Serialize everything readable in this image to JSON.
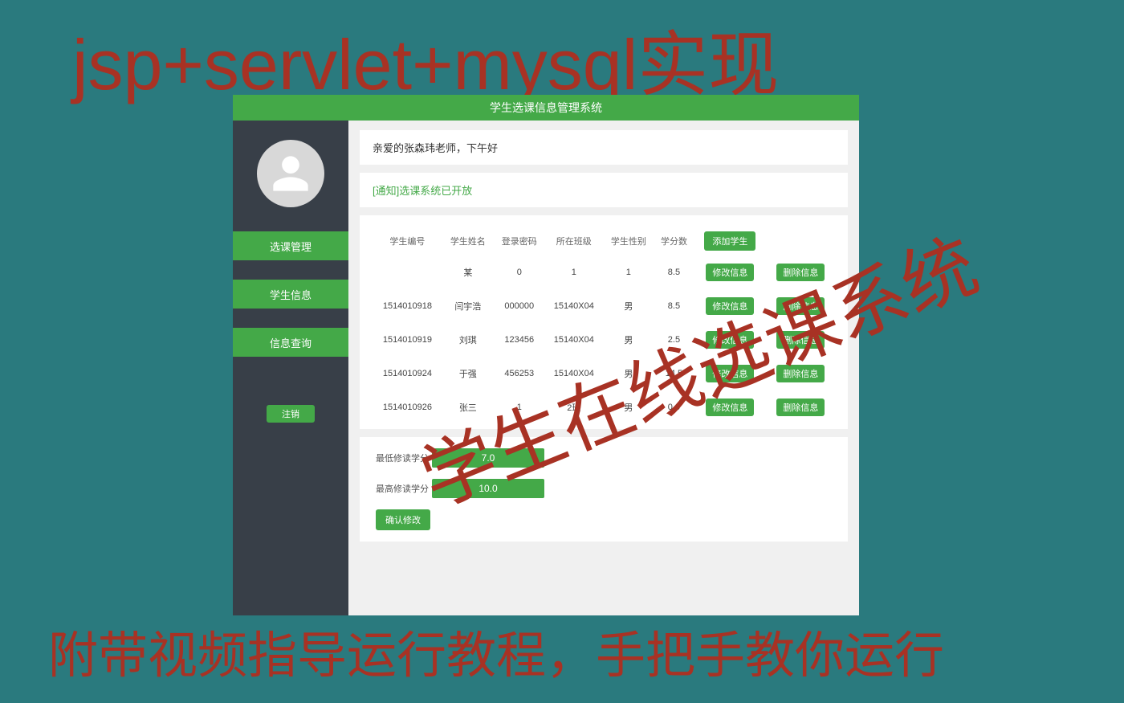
{
  "banner": {
    "top": "jsp+servlet+mysql实现",
    "bottom": "附带视频指导运行教程，手把手教你运行",
    "watermark": "学生在线选课系统"
  },
  "topbar": {
    "title": "学生选课信息管理系统"
  },
  "sidebar": {
    "nav": [
      {
        "label": "选课管理"
      },
      {
        "label": "学生信息"
      },
      {
        "label": "信息查询"
      }
    ],
    "logout": "注销"
  },
  "greeting": "亲爱的张森玮老师，下午好",
  "notice": "[通知]选课系统已开放",
  "table": {
    "headers": [
      "学生编号",
      "学生姓名",
      "登录密码",
      "所在班级",
      "学生性别",
      "学分数"
    ],
    "add_label": "添加学生",
    "edit_label": "修改信息",
    "delete_label": "删除信息",
    "rows": [
      {
        "id": "",
        "name": "某",
        "pwd": "0",
        "class": "1",
        "sex": "1",
        "credit": "8.5"
      },
      {
        "id": "1514010918",
        "name": "闫宇浩",
        "pwd": "000000",
        "class": "15140X04",
        "sex": "男",
        "credit": "8.5"
      },
      {
        "id": "1514010919",
        "name": "刘琪",
        "pwd": "123456",
        "class": "15140X04",
        "sex": "男",
        "credit": "2.5"
      },
      {
        "id": "1514010924",
        "name": "于强",
        "pwd": "456253",
        "class": "15140X04",
        "sex": "男",
        "credit": "14.5"
      },
      {
        "id": "1514010926",
        "name": "张三",
        "pwd": "1",
        "class": "2班",
        "sex": "男",
        "credit": "0.0"
      }
    ]
  },
  "credits": {
    "min_label": "最低修读学分",
    "min_value": "7.0",
    "max_label": "最高修读学分",
    "max_value": "10.0",
    "confirm": "确认修改"
  }
}
